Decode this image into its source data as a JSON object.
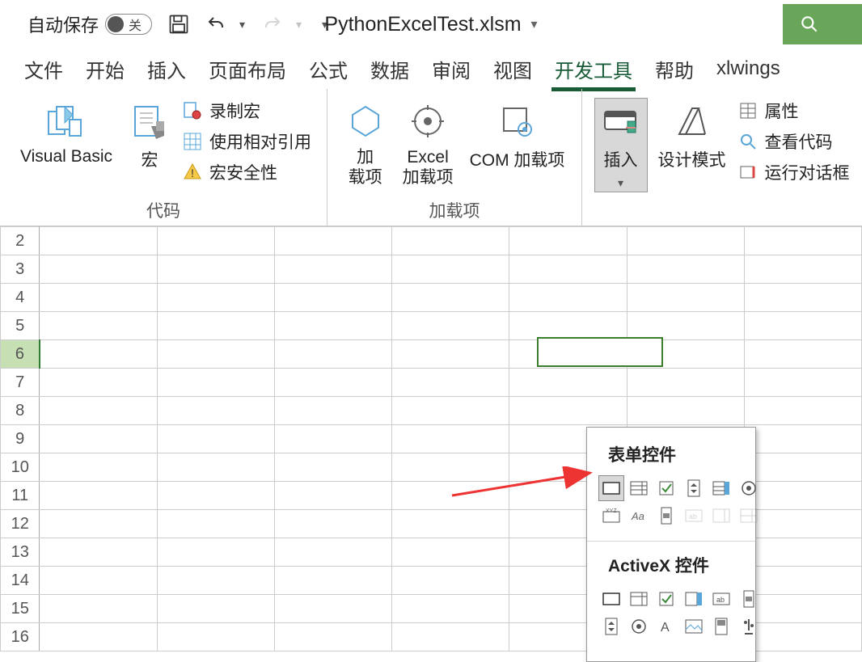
{
  "titlebar": {
    "autosave_label": "自动保存",
    "toggle_off": "关",
    "filename": "PythonExcelTest.xlsm"
  },
  "tabs": [
    "文件",
    "开始",
    "插入",
    "页面布局",
    "公式",
    "数据",
    "审阅",
    "视图",
    "开发工具",
    "帮助",
    "xlwings"
  ],
  "active_tab": "开发工具",
  "ribbon": {
    "groups": {
      "code": {
        "label": "代码",
        "vb": "Visual Basic",
        "macro": "宏",
        "record": "录制宏",
        "relref": "使用相对引用",
        "security": "宏安全性"
      },
      "addins": {
        "label": "加载项",
        "addin1": "加载项",
        "addin2": "Excel 加载项",
        "com": "COM 加载项"
      },
      "controls": {
        "insert": "插入",
        "design": "设计模式",
        "props": "属性",
        "viewcode": "查看代码",
        "rundialog": "运行对话框"
      }
    }
  },
  "popup": {
    "form_title": "表单控件",
    "activex_title": "ActiveX 控件"
  },
  "rows": [
    2,
    3,
    4,
    5,
    6,
    7,
    8,
    9,
    10,
    11,
    12,
    13,
    14,
    15,
    16
  ],
  "selected_row": 6
}
